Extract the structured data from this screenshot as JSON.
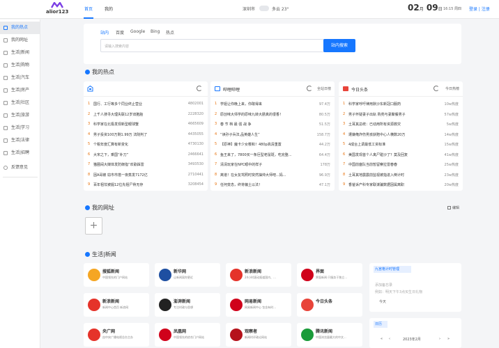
{
  "header": {
    "logo_text": "alior123",
    "tabs": [
      "首页",
      "我的"
    ],
    "location": "深圳市",
    "weather": "多云 23°",
    "month": "02",
    "month_unit": "月",
    "day": "09",
    "day_unit": "日",
    "time": "16:15 周四",
    "login": "登录 | 注册"
  },
  "sidebar": {
    "items": [
      "我的热点",
      "我的网址",
      "生活|新闻",
      "生活|购物",
      "生活|汽车",
      "生活|房产",
      "生活|社区",
      "生活|旅游",
      "生活|学习",
      "生活|法律",
      "生活|招聘"
    ],
    "feedback": "反馈意见"
  },
  "search": {
    "tabs": [
      "站内",
      "百度",
      "Google",
      "Bing",
      "热点"
    ],
    "placeholder": "请输入搜索内容",
    "button": "站内搜索"
  },
  "hot_section": {
    "title": "我的热点"
  },
  "hot_cards": [
    {
      "name": "",
      "more": "",
      "items": [
        {
          "n": "1",
          "t": "国行、工行等多个同业终止营业",
          "v": "4802001"
        },
        {
          "n": "2",
          "t": "上千人搜寻大理失联12岁双胞胎",
          "v": "2228320"
        },
        {
          "n": "3",
          "t": "科学家在北极发现新型眼球蟹",
          "v": "4665609"
        },
        {
          "n": "4",
          "t": "男子投资100万剩1.99万 法院判了",
          "v": "4435055"
        },
        {
          "n": "5",
          "t": "个税年度汇算有新变化",
          "v": "4730130"
        },
        {
          "n": "6",
          "t": "大宋之下，乘国“补刀”",
          "v": "2466641"
        },
        {
          "n": "7",
          "t": "猫圈闹大媒体发防御指“欢歌踩雷",
          "v": "3493530"
        },
        {
          "n": "8",
          "t": "因A哥被 窃市市搭一夜蒸发7172亿",
          "v": "2710441"
        },
        {
          "n": "9",
          "t": "百年祖坟被掘12位先祖尸骨无存",
          "v": "3208454"
        }
      ]
    },
    {
      "name": "哔哩哔哩",
      "more": "全站日榜",
      "items": [
        {
          "n": "1",
          "t": "学姐让你晚上来，你敢得来",
          "v": "97.4万"
        },
        {
          "n": "2",
          "t": "原创味大师学的原味九转大肠真的很香！",
          "v": "80.5万"
        },
        {
          "n": "3",
          "t": "春 节 档 最 强 战 争",
          "v": "51.5万"
        },
        {
          "n": "4",
          "t": "“读孙子兵法,品英雄人生”",
          "v": "158.7万"
        },
        {
          "n": "5",
          "t": "【原神】魔卡少女樱和！480p高清重置",
          "v": "44.2万"
        },
        {
          "n": "6",
          "t": "鱼王来了，7800买一条巨型老鼠斑，吃完整...",
          "v": "64.4万"
        },
        {
          "n": "7",
          "t": "清清玩家在NPC眼中的样子",
          "v": "178万"
        },
        {
          "n": "8",
          "t": "离谱！在女友驾照时突然抽帅大师吧...妈...",
          "v": "96.9万"
        },
        {
          "n": "9",
          "t": "任何变态，终将偏土以法！",
          "v": "47.1万"
        }
      ]
    },
    {
      "name": "今日头条",
      "more": "今日热榜",
      "items": [
        {
          "n": "1",
          "t": "科学家呼吁律用默沙东新冠口服药",
          "v": "10w热度"
        },
        {
          "n": "2",
          "t": "男子怀疑妻子出轨 购亮与妻聚餐男子",
          "v": "57w热度"
        },
        {
          "n": "3",
          "t": "土耳其总统：已动用所有资源救灾",
          "v": "5w热度"
        },
        {
          "n": "4",
          "t": "遭嫌俺炸伤男孩获赔中心人横数20万",
          "v": "14w热度"
        },
        {
          "n": "5",
          "t": "4成台上调最低工资标准",
          "v": "15w热度"
        },
        {
          "n": "6",
          "t": "美国发现首个人禽尸碰沙了？莫及回复",
          "v": "41w热度"
        },
        {
          "n": "7",
          "t": "中国前塞队当前暂留察拉雷春春",
          "v": "25w热度"
        },
        {
          "n": "8",
          "t": "土耳其地震震前监视被指进入倒计时",
          "v": "23w热度"
        },
        {
          "n": "9",
          "t": "香爸诉产科专家联谋骗数据因属离职",
          "v": "20w热度"
        }
      ]
    }
  ],
  "sites_section": {
    "title": "我的网址",
    "edit": "编辑",
    "add": "+"
  },
  "news_section": {
    "title": "生活|新闻"
  },
  "sites": [
    {
      "name": "搜狐新闻",
      "desc": "中国领先的门户网站",
      "color": "#f5a623"
    },
    {
      "name": "新华网",
      "desc": "让新闻离你更近",
      "color": "#1e4fa1"
    },
    {
      "name": "新浪新闻",
      "desc": "24小时滚动报道国内、...",
      "color": "#e5332a"
    },
    {
      "name": "界面",
      "desc": "界面新闻·只服务于独立...",
      "color": "#d0021b"
    },
    {
      "name": "新浪新闻",
      "desc": "新闻中心首页 新浪网",
      "color": "#e5332a"
    },
    {
      "name": "澎湃新闻",
      "desc": "专注时政与思想",
      "color": "#222222"
    },
    {
      "name": "网易新闻",
      "desc": "网易新闻中心 包含有时...",
      "color": "#d0021b"
    },
    {
      "name": "今日头条",
      "desc": "",
      "color": "#e8443a"
    },
    {
      "name": "央广网",
      "desc": "由中央广播电视总台主办",
      "color": "#e5332a"
    },
    {
      "name": "凤凰网",
      "desc": "中国领先的综合门户网站",
      "color": "#d0021b"
    },
    {
      "name": "观察者",
      "desc": "新闻时评政论网站",
      "color": "#b5121b"
    },
    {
      "name": "腾讯新闻",
      "desc": "中国浏览量最大的中文...",
      "color": "#1a9b3a"
    }
  ],
  "memo": {
    "title": "九宫格计时管理",
    "placeholder1": "添加备忘录",
    "placeholder2": "例如：明天下午3点买生日礼物",
    "date": "今天"
  },
  "calendar": {
    "title": "日历",
    "month": "2023年2月"
  }
}
